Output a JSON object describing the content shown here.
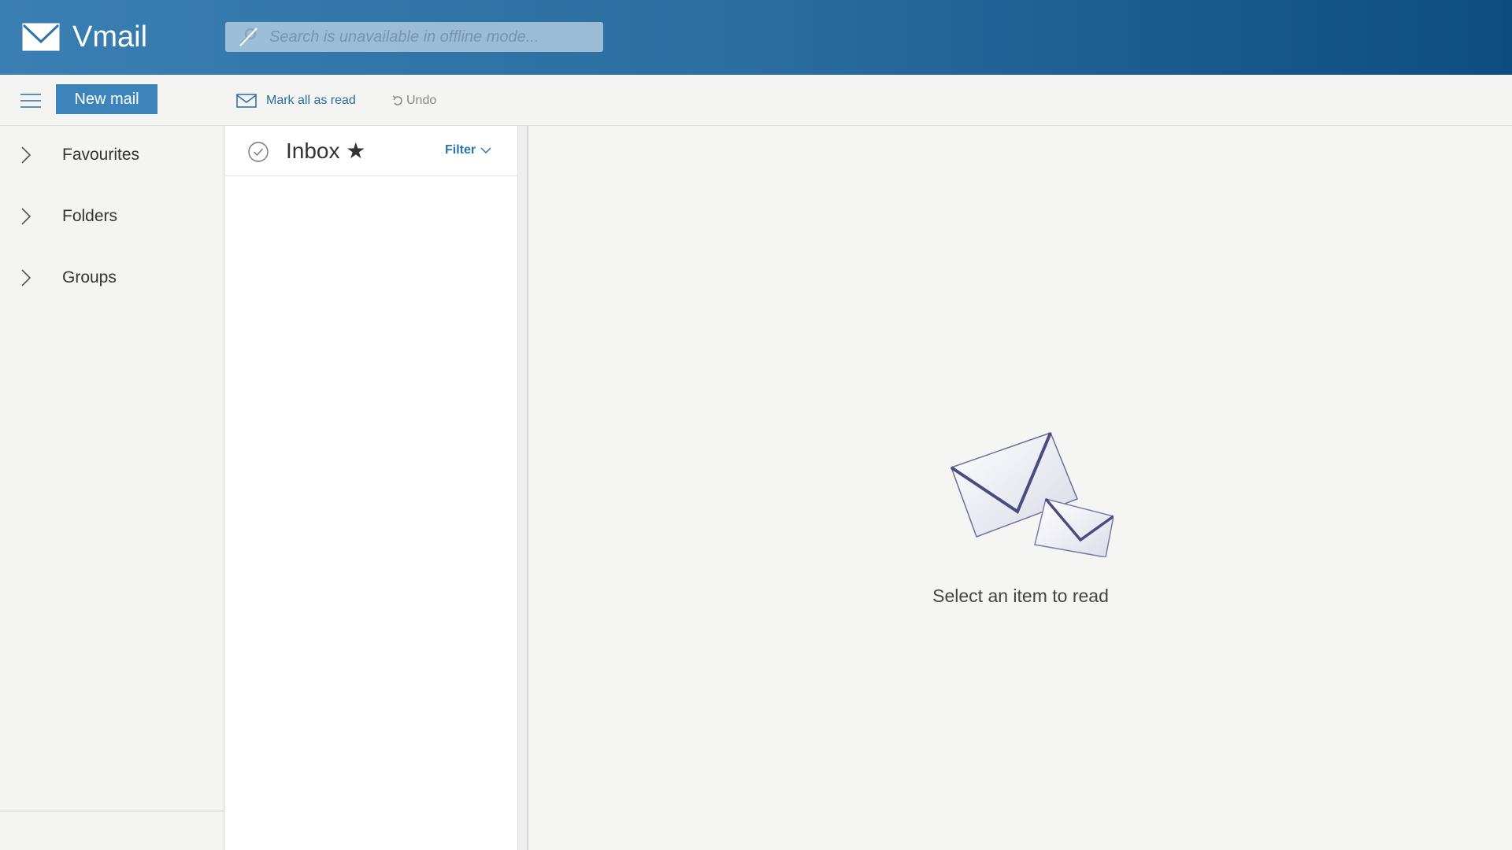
{
  "app": {
    "name": "Vmail"
  },
  "search": {
    "placeholder": "Search is unavailable in offline mode..."
  },
  "toolbar": {
    "new_mail_label": "New mail",
    "mark_all_read_label": "Mark all as read",
    "undo_label": "Undo"
  },
  "sidebar": {
    "items": [
      {
        "label": "Favourites",
        "icon": "chevron-right-icon"
      },
      {
        "label": "Folders",
        "icon": "chevron-right-icon"
      },
      {
        "label": "Groups",
        "icon": "chevron-right-icon"
      }
    ]
  },
  "message_list": {
    "title": "Inbox ★",
    "filter_label": "Filter"
  },
  "reading_pane": {
    "empty_text": "Select an item to read"
  },
  "colors": {
    "header_start": "#3a7fb3",
    "header_end": "#0d4d80",
    "accent": "#3c84ba",
    "link": "#2a74b4"
  }
}
